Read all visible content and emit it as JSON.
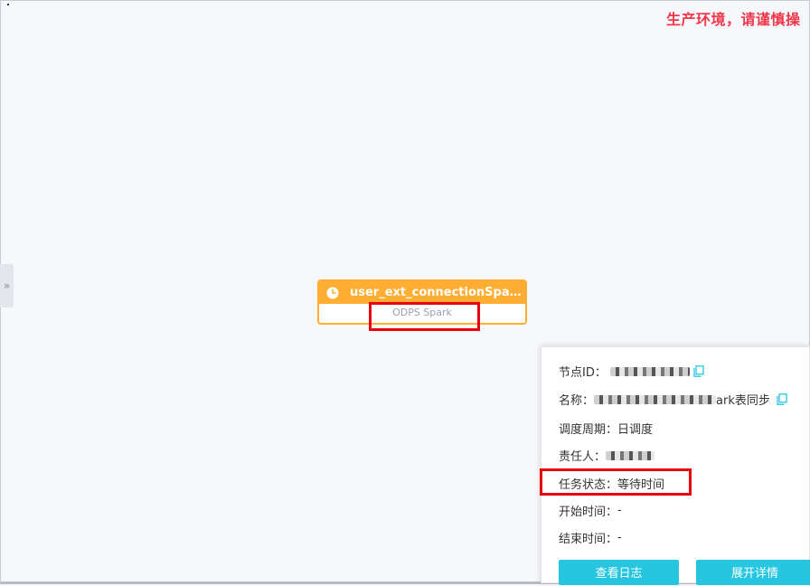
{
  "env_warning": "生产环境，请谨慎操",
  "sidebar_toggle": "»",
  "node": {
    "name": "user_ext_connectionSpar...",
    "type": "ODPS Spark"
  },
  "panel": {
    "node_id_label": "节点ID：",
    "name_label": "名称：",
    "name_visible_suffix": "ark表同步",
    "cycle_label": "调度周期：",
    "cycle_value": "日调度",
    "owner_label": "责任人：",
    "status_label": "任务状态：",
    "status_value": "等待时间",
    "start_label": "开始时间：",
    "start_value": "-",
    "end_label": "结束时间：",
    "end_value": "-",
    "view_log_button": "查看日志",
    "expand_detail_button": "展开详情"
  },
  "colors": {
    "node_accent": "#ffad33",
    "warning_text": "#f2374a",
    "button": "#26c6e0",
    "highlight_box": "#e8000b"
  }
}
